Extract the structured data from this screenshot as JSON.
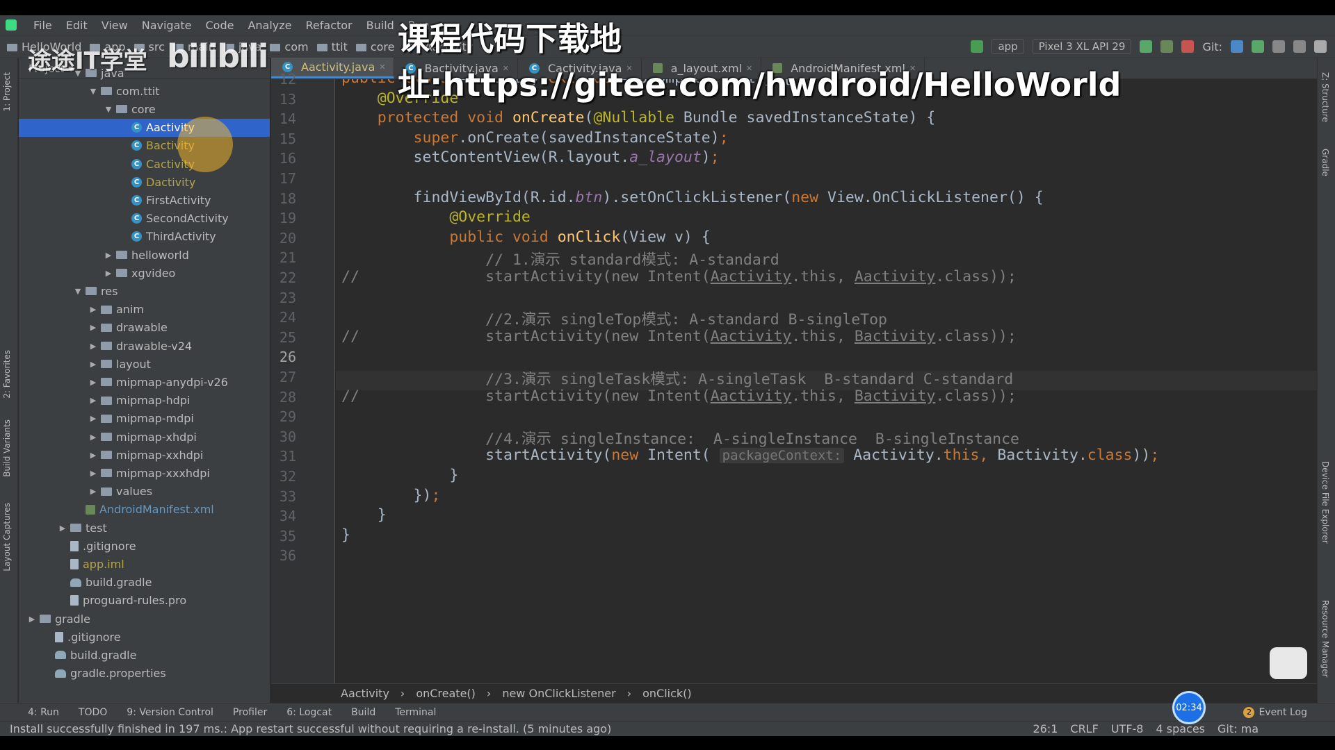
{
  "menu": [
    "File",
    "Edit",
    "View",
    "Navigate",
    "Code",
    "Analyze",
    "Refactor",
    "Build",
    "Run"
  ],
  "toolbar": {
    "crumbs": [
      "HelloWorld",
      "app",
      "src",
      "main",
      "java",
      "com",
      "ttit",
      "core",
      "Aactivity"
    ],
    "run_config": "app",
    "device": "Pixel 3 XL API 29",
    "git_label": "Git:"
  },
  "left_strip": [
    "1: Project",
    "2: Favorites",
    "Build Variants",
    "Layout Captures"
  ],
  "right_strip": [
    "Z: Structure",
    "Gradle",
    "Device File Explorer",
    "Resource Manager"
  ],
  "project": {
    "header": "Project",
    "tree": [
      {
        "label": "java",
        "depth": 4,
        "arrow": "▼",
        "icon": "folder"
      },
      {
        "label": "com.ttit",
        "depth": 5,
        "arrow": "▼",
        "icon": "folder"
      },
      {
        "label": "core",
        "depth": 6,
        "arrow": "▼",
        "icon": "folder"
      },
      {
        "label": "Aactivity",
        "depth": 7,
        "arrow": "",
        "icon": "class",
        "selected": true,
        "color": "yellow"
      },
      {
        "label": "Bactivity",
        "depth": 7,
        "arrow": "",
        "icon": "class",
        "color": "yellow"
      },
      {
        "label": "Cactivity",
        "depth": 7,
        "arrow": "",
        "icon": "class",
        "color": "yellow"
      },
      {
        "label": "Dactivity",
        "depth": 7,
        "arrow": "",
        "icon": "class",
        "color": "yellow"
      },
      {
        "label": "FirstActivity",
        "depth": 7,
        "arrow": "",
        "icon": "class"
      },
      {
        "label": "SecondActivity",
        "depth": 7,
        "arrow": "",
        "icon": "class"
      },
      {
        "label": "ThirdActivity",
        "depth": 7,
        "arrow": "",
        "icon": "class"
      },
      {
        "label": "helloworld",
        "depth": 6,
        "arrow": "▶",
        "icon": "folder"
      },
      {
        "label": "xgvideo",
        "depth": 6,
        "arrow": "▶",
        "icon": "folder"
      },
      {
        "label": "res",
        "depth": 4,
        "arrow": "▼",
        "icon": "folder"
      },
      {
        "label": "anim",
        "depth": 5,
        "arrow": "▶",
        "icon": "folder"
      },
      {
        "label": "drawable",
        "depth": 5,
        "arrow": "▶",
        "icon": "folder"
      },
      {
        "label": "drawable-v24",
        "depth": 5,
        "arrow": "▶",
        "icon": "folder"
      },
      {
        "label": "layout",
        "depth": 5,
        "arrow": "▶",
        "icon": "folder"
      },
      {
        "label": "mipmap-anydpi-v26",
        "depth": 5,
        "arrow": "▶",
        "icon": "folder"
      },
      {
        "label": "mipmap-hdpi",
        "depth": 5,
        "arrow": "▶",
        "icon": "folder"
      },
      {
        "label": "mipmap-mdpi",
        "depth": 5,
        "arrow": "▶",
        "icon": "folder"
      },
      {
        "label": "mipmap-xhdpi",
        "depth": 5,
        "arrow": "▶",
        "icon": "folder"
      },
      {
        "label": "mipmap-xxhdpi",
        "depth": 5,
        "arrow": "▶",
        "icon": "folder"
      },
      {
        "label": "mipmap-xxxhdpi",
        "depth": 5,
        "arrow": "▶",
        "icon": "folder"
      },
      {
        "label": "values",
        "depth": 5,
        "arrow": "▶",
        "icon": "folder"
      },
      {
        "label": "AndroidManifest.xml",
        "depth": 4,
        "arrow": "",
        "icon": "xml",
        "color": "blue"
      },
      {
        "label": "test",
        "depth": 3,
        "arrow": "▶",
        "icon": "folder"
      },
      {
        "label": ".gitignore",
        "depth": 3,
        "arrow": "",
        "icon": "file"
      },
      {
        "label": "app.iml",
        "depth": 3,
        "arrow": "",
        "icon": "file",
        "color": "yellow"
      },
      {
        "label": "build.gradle",
        "depth": 3,
        "arrow": "",
        "icon": "gradle"
      },
      {
        "label": "proguard-rules.pro",
        "depth": 3,
        "arrow": "",
        "icon": "file"
      },
      {
        "label": "gradle",
        "depth": 1,
        "arrow": "▶",
        "icon": "folder"
      },
      {
        "label": ".gitignore",
        "depth": 2,
        "arrow": "",
        "icon": "file"
      },
      {
        "label": "build.gradle",
        "depth": 2,
        "arrow": "",
        "icon": "gradle"
      },
      {
        "label": "gradle.properties",
        "depth": 2,
        "arrow": "",
        "icon": "gradle"
      }
    ]
  },
  "tabs": [
    {
      "label": "Aactivity.java",
      "icon": "class",
      "active": true
    },
    {
      "label": "Bactivity.java",
      "icon": "class"
    },
    {
      "label": "Cactivity.java",
      "icon": "class"
    },
    {
      "label": "a_layout.xml",
      "icon": "xml"
    },
    {
      "label": "AndroidManifest.xml",
      "icon": "xml"
    }
  ],
  "editor": {
    "lines": [
      {
        "n": "12",
        "html": "<span class='k'>public class</span> Aactivity <span class='k'>extends</span> AppCompatActivity {"
      },
      {
        "n": "13",
        "html": "    <span class='a'>@Override</span>"
      },
      {
        "n": "14",
        "html": "    <span class='k'>protected void</span> <span class='m'>onCreate</span>(<span class='a'>@Nullable</span> Bundle savedInstanceState) {"
      },
      {
        "n": "15",
        "html": "        <span class='k'>super</span>.onCreate(savedInstanceState)<span class='k'>;</span>"
      },
      {
        "n": "16",
        "html": "        setContentView(R.layout.<span class='i'>a_layout</span>)<span class='k'>;</span>"
      },
      {
        "n": "17",
        "html": ""
      },
      {
        "n": "18",
        "html": "        findViewById(R.id.<span class='i'>btn</span>).setOnClickListener(<span class='k'>new</span> View.OnClickListener() {"
      },
      {
        "n": "19",
        "html": "            <span class='a'>@Override</span>"
      },
      {
        "n": "20",
        "html": "            <span class='k'>public void</span> <span class='m'>onClick</span>(View v) {"
      },
      {
        "n": "21",
        "html": "                <span class='cm'>// 1.演示 standard模式: A-standard</span>"
      },
      {
        "n": "22",
        "html": "<span class='cm'>//              startActivity(new Intent(<span class='u'>Aactivity</span>.this, <span class='u'>Aactivity</span>.class));</span>"
      },
      {
        "n": "23",
        "html": ""
      },
      {
        "n": "24",
        "html": "                <span class='cm'>//2.演示 singleTop模式: A-standard B-singleTop</span>"
      },
      {
        "n": "25",
        "html": "<span class='cm'>//              startActivity(new Intent(<span class='u'>Aactivity</span>.this, <span class='u'>Bactivity</span>.class));</span>"
      },
      {
        "n": "26",
        "html": ""
      },
      {
        "n": "27",
        "html": "                <span class='cm'>//3.演示 singleTask模式: A-singleTask  B-standard C-standard</span>"
      },
      {
        "n": "28",
        "html": "<span class='cm'>//              startActivity(new Intent(<span class='u'>Aactivity</span>.this, <span class='u'>Bactivity</span>.class));</span>"
      },
      {
        "n": "29",
        "html": ""
      },
      {
        "n": "30",
        "html": "                <span class='cm'>//4.演示 singleInstance:  A-singleInstance  B-singleInstance</span>"
      },
      {
        "n": "31",
        "html": "                startActivity(<span class='k'>new</span> Intent( <span class='hint'>packageContext:</span> Aactivity.<span class='k'>this,</span> Bactivity.<span class='k'>class</span>))<span class='k'>;</span>"
      },
      {
        "n": "32",
        "html": "            }"
      },
      {
        "n": "33",
        "html": "        })<span class='k'>;</span>"
      },
      {
        "n": "34",
        "html": "    }"
      },
      {
        "n": "35",
        "html": "}"
      },
      {
        "n": "36",
        "html": ""
      }
    ]
  },
  "breadcrumb": [
    "Aactivity",
    "onCreate()",
    "new OnClickListener",
    "onClick()"
  ],
  "bottom_tabs": [
    "4: Run",
    "TODO",
    "9: Version Control",
    "Profiler",
    "6: Logcat",
    "Build",
    "Terminal"
  ],
  "event_log": "Event Log",
  "event_log_count": "2",
  "status": {
    "message": "Install successfully finished in 197 ms.: App restart successful without requiring a re-install. (5 minutes ago)",
    "position": "26:1",
    "line_sep": "CRLF",
    "encoding": "UTF-8",
    "indent": "4 spaces",
    "git": "Git: ma"
  },
  "overlay": {
    "watermark": "课程代码下载地址:https://gitee.com/hwdroid/HelloWorld",
    "brand": "途途IT学堂",
    "bili": "bilibili",
    "timer": "02:34"
  },
  "colors": {
    "accent": "#2f65ca",
    "bg": "#2b2b2b",
    "panel": "#3c3f41"
  }
}
